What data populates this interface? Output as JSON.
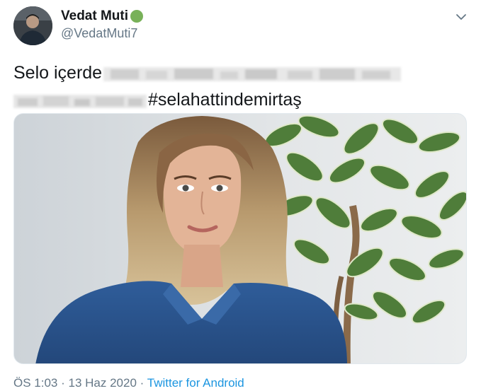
{
  "author": {
    "display_name": "Vedat Muti",
    "handle": "@VedatMuti7",
    "avatar_icon": "profile-photo",
    "badge_icon": "green-circle-emoji",
    "badge_color": "#78b159"
  },
  "tweet": {
    "text_start": "Selo içerde",
    "hashtag": "#selahattindemirtaş"
  },
  "meta": {
    "time": "ÖS 1:03",
    "date": "13 Haz 2020",
    "separator": "·",
    "source": "Twitter for Android"
  },
  "colors": {
    "link": "#1b95e0",
    "muted": "#657786",
    "text": "#14171a"
  }
}
